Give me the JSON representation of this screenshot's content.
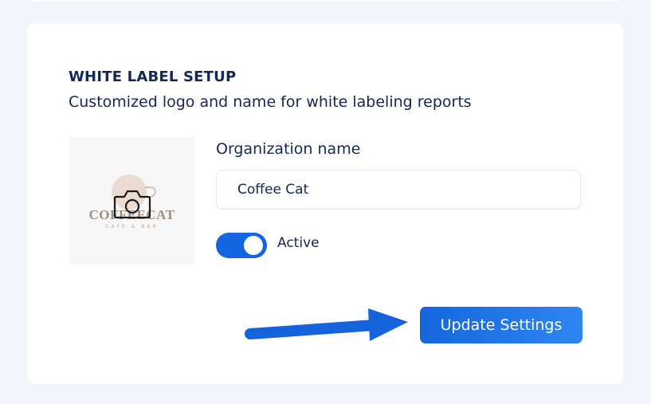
{
  "header": {
    "title": "WHITE LABEL SETUP",
    "subtitle": "Customized logo and name for white labeling reports"
  },
  "logo": {
    "brand_text": "COFFEECAT",
    "brand_subtext": "CAFE & BAR",
    "upload_icon": "camera-icon"
  },
  "organization": {
    "label": "Organization name",
    "value": "Coffee Cat"
  },
  "active_toggle": {
    "label": "Active",
    "checked": true
  },
  "actions": {
    "update_label": "Update Settings"
  },
  "colors": {
    "accent": "#1465e0",
    "text": "#12275a",
    "background": "#f2f5fb"
  }
}
